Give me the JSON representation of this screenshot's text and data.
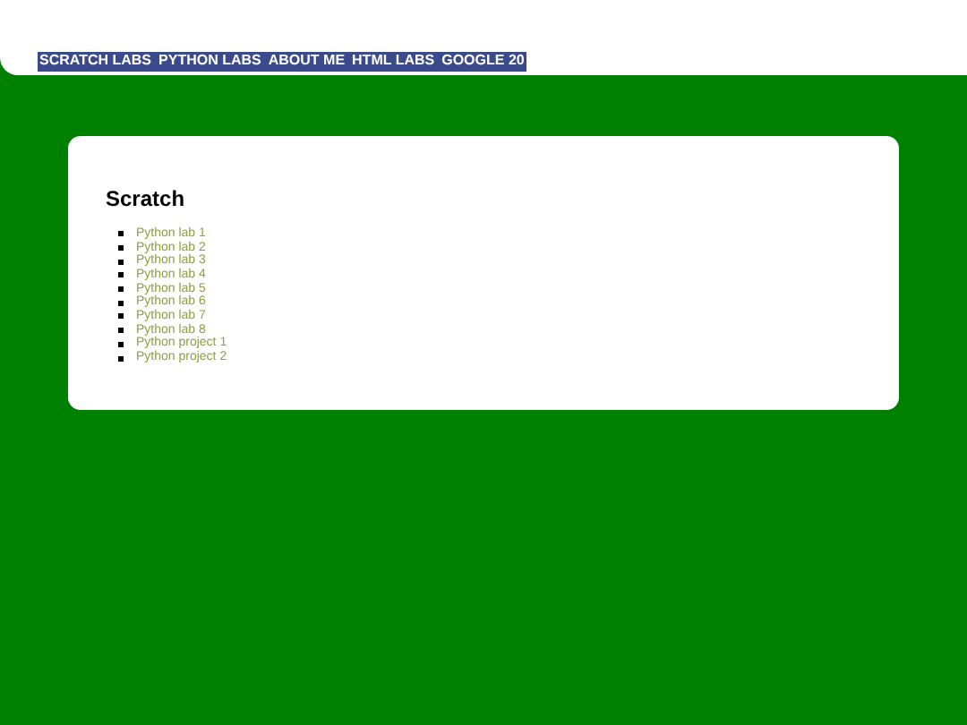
{
  "nav": [
    {
      "label": "SCRATCH LABS"
    },
    {
      "label": "PYTHON LABS"
    },
    {
      "label": "ABOUT ME"
    },
    {
      "label": "HTML LABS"
    },
    {
      "label": "GOOGLE 20"
    }
  ],
  "card": {
    "heading": "Scratch",
    "links": [
      "Python lab 1",
      "Python lab 2",
      "Python lab 3",
      "Python lab 4",
      "Python lab 5",
      "Python lab 6",
      "Python lab 7",
      "Python lab 8",
      "Python project 1",
      "Python project 2"
    ]
  }
}
